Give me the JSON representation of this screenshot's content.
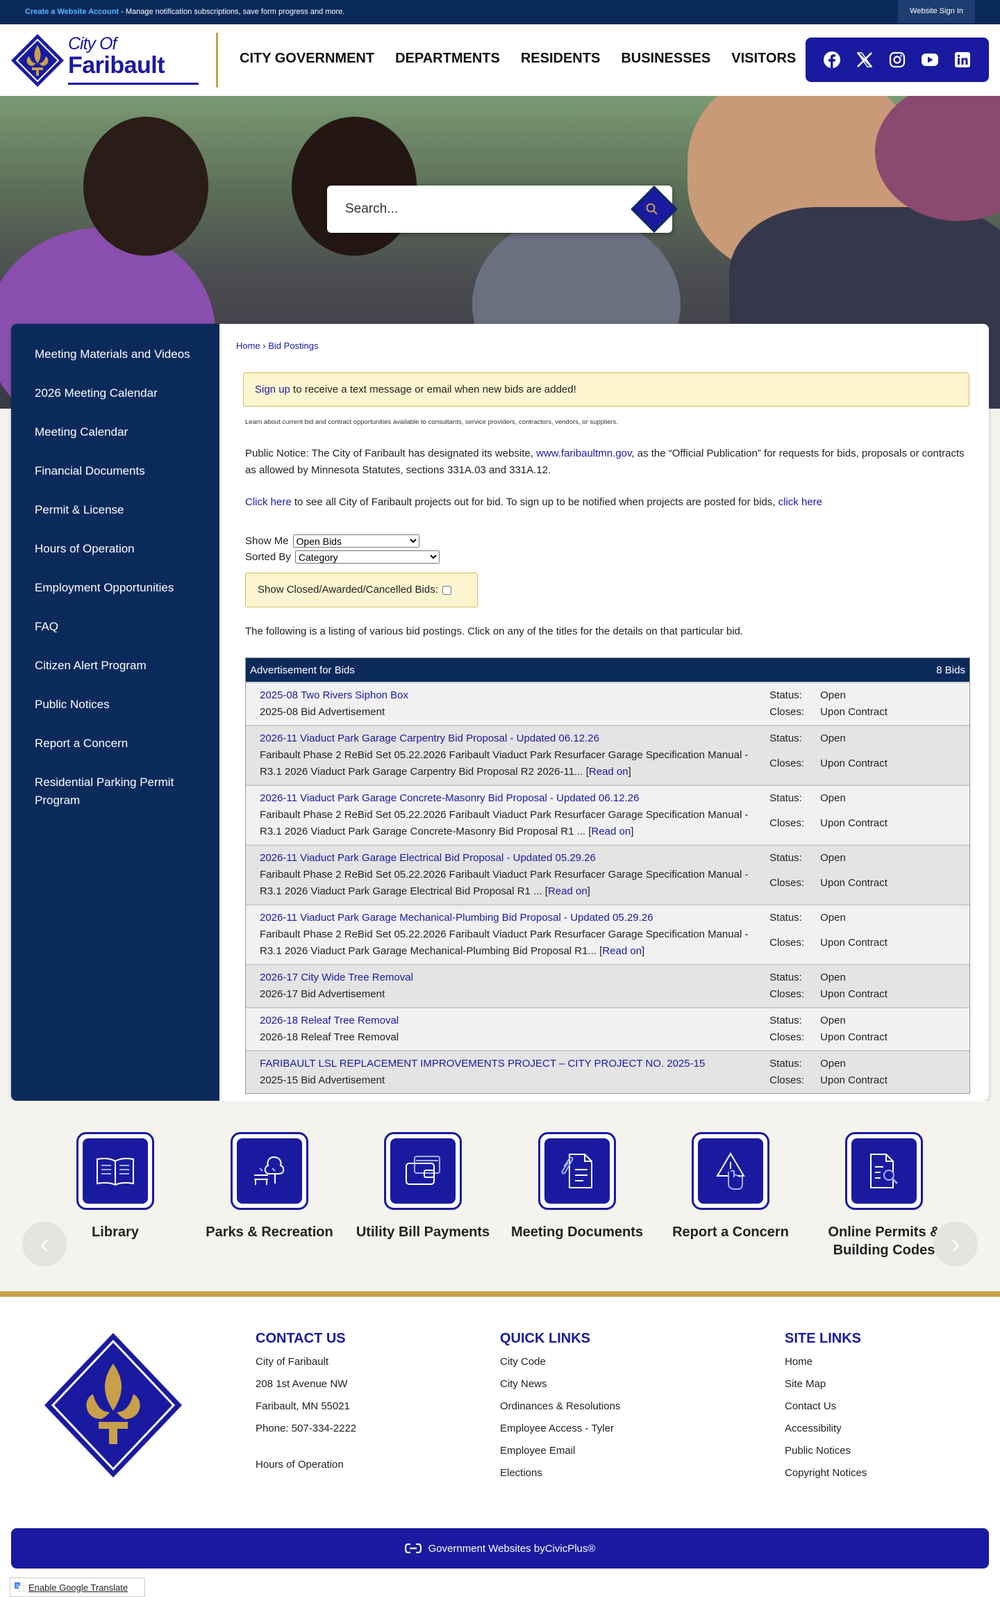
{
  "topbar": {
    "create_link": "Create a Website Account",
    "message": " - Manage notification subscriptions, save form progress and more.",
    "signin": "Website Sign In"
  },
  "header": {
    "logo_city": "City Of",
    "logo_name": "Faribault",
    "nav": [
      "CITY GOVERNMENT",
      "DEPARTMENTS",
      "RESIDENTS",
      "BUSINESSES",
      "VISITORS"
    ],
    "social_icons": [
      "facebook-icon",
      "x-icon",
      "instagram-icon",
      "youtube-icon",
      "linkedin-icon"
    ]
  },
  "search": {
    "placeholder": "Search..."
  },
  "sidebar": {
    "items": [
      "Meeting Materials and Videos",
      "2026 Meeting Calendar",
      "Meeting Calendar",
      "Financial Documents",
      "Permit & License",
      "Hours of Operation",
      "Employment Opportunities",
      "FAQ",
      "Citizen Alert Program",
      "Public Notices",
      "Report a Concern",
      "Residential Parking Permit Program"
    ]
  },
  "breadcrumb": {
    "home": "Home",
    "sep": " › ",
    "current": "Bid Postings"
  },
  "alert": {
    "link": "Sign up",
    "text": " to receive a text message or email when new bids are added!"
  },
  "intro_small": "Learn about current bid and contract opportunities available to consultants, service providers, contractors, vendors, or suppliers.",
  "notice": {
    "pre": "Public Notice: The City of Faribault has designated its website, ",
    "link": "www.faribaultmn.gov",
    "post": ", as the “Official Publication” for requests for bids, proposals or contracts as allowed by Minnesota Statutes, sections 331A.03 and 331A.12."
  },
  "projects": {
    "link1": "Click here",
    "mid": " to see all City of Faribault projects out for bid. To sign up to be notified when projects are posted for bids, ",
    "link2": "click here"
  },
  "filters": {
    "show_label": "Show Me",
    "show_value": "Open Bids",
    "sort_label": "Sorted By",
    "sort_value": "Category",
    "closed_label": "Show Closed/Awarded/Cancelled Bids:"
  },
  "listing_text": "The following is a listing of various bid postings. Click on any of the titles for the details on that particular bid.",
  "bids": {
    "header": "Advertisement for Bids",
    "count": "8 Bids",
    "status_label": "Status:",
    "closes_label": "Closes:",
    "read_on": "Read on",
    "rows": [
      {
        "title": "2025-08 Two Rivers Siphon Box",
        "desc": "2025-08 Bid Advertisement",
        "has_read_on": false,
        "status": "Open",
        "closes": "Upon Contract"
      },
      {
        "title": "2026-11 Viaduct Park Garage Carpentry Bid Proposal - Updated 06.12.26",
        "desc": "Faribault Phase 2 ReBid Set 05.22.2026 Faribault Viaduct Park Resurfacer Garage Specification Manual - R3.1 2026 Viaduct Park Garage Carpentry Bid Proposal R2 2026-11... ",
        "has_read_on": true,
        "status": "Open",
        "closes": "Upon Contract"
      },
      {
        "title": "2026-11 Viaduct Park Garage Concrete-Masonry Bid Proposal - Updated 06.12.26",
        "desc": "Faribault Phase 2 ReBid Set 05.22.2026 Faribault Viaduct Park Resurfacer Garage Specification Manual - R3.1 2026 Viaduct Park Garage Concrete-Masonry Bid Proposal R1 ... ",
        "has_read_on": true,
        "status": "Open",
        "closes": "Upon Contract"
      },
      {
        "title": "2026-11 Viaduct Park Garage Electrical Bid Proposal - Updated 05.29.26",
        "desc": "Faribault Phase 2 ReBid Set 05.22.2026 Faribault Viaduct Park Resurfacer Garage Specification Manual - R3.1 2026 Viaduct Park Garage Electrical Bid Proposal R1 ... ",
        "has_read_on": true,
        "status": "Open",
        "closes": "Upon Contract"
      },
      {
        "title": "2026-11 Viaduct Park Garage Mechanical-Plumbing Bid Proposal - Updated 05.29.26",
        "desc": "Faribault Phase 2 ReBid Set 05.22.2026 Faribault Viaduct Park Resurfacer Garage Specification Manual - R3.1 2026 Viaduct Park Garage Mechanical-Plumbing Bid Proposal R1... ",
        "has_read_on": true,
        "status": "Open",
        "closes": "Upon Contract"
      },
      {
        "title": "2026-17 City Wide Tree Removal",
        "desc": "2026-17 Bid Advertisement",
        "has_read_on": false,
        "status": "Open",
        "closes": "Upon Contract"
      },
      {
        "title": "2026-18 Releaf Tree Removal",
        "desc": "2026-18 Releaf Tree Removal",
        "has_read_on": false,
        "status": "Open",
        "closes": "Upon Contract"
      },
      {
        "title": "FARIBAULT LSL REPLACEMENT IMPROVEMENTS PROJECT – CITY PROJECT NO. 2025-15",
        "desc": "2025-15 Bid Advertisement",
        "has_read_on": false,
        "status": "Open",
        "closes": "Upon Contract"
      }
    ]
  },
  "quick_links": [
    {
      "label": "Library",
      "icon": "book-icon"
    },
    {
      "label": "Parks & Recreation",
      "icon": "park-icon"
    },
    {
      "label": "Utility Bill Payments",
      "icon": "wallet-icon"
    },
    {
      "label": "Meeting Documents",
      "icon": "document-icon"
    },
    {
      "label": "Report a Concern",
      "icon": "alert-hand-icon"
    },
    {
      "label": "Online Permits & Building Codes",
      "icon": "search-document-icon"
    }
  ],
  "footer": {
    "contact": {
      "title": "CONTACT US",
      "lines": [
        "City of Faribault",
        "208 1st Avenue NW",
        "Faribault, MN 55021",
        "Phone: 507-334-2222"
      ],
      "hours": "Hours of Operation"
    },
    "quick": {
      "title": "QUICK LINKS",
      "links": [
        "City Code",
        "City News",
        "Ordinances & Resolutions",
        "Employee Access - Tyler",
        "Employee Email",
        "Elections"
      ]
    },
    "site": {
      "title": "SITE LINKS",
      "links": [
        "Home",
        "Site Map",
        "Contact Us",
        "Accessibility",
        "Public Notices",
        "Copyright Notices"
      ]
    },
    "civic_pre": "Government Websites by ",
    "civic_link": "CivicPlus®",
    "translate": "Enable Google Translate"
  },
  "colors": {
    "navy": "#0b2a5c",
    "brand_blue": "#1a1aa0",
    "gold": "#c8a04a",
    "alert_bg": "#fdf5cf"
  }
}
